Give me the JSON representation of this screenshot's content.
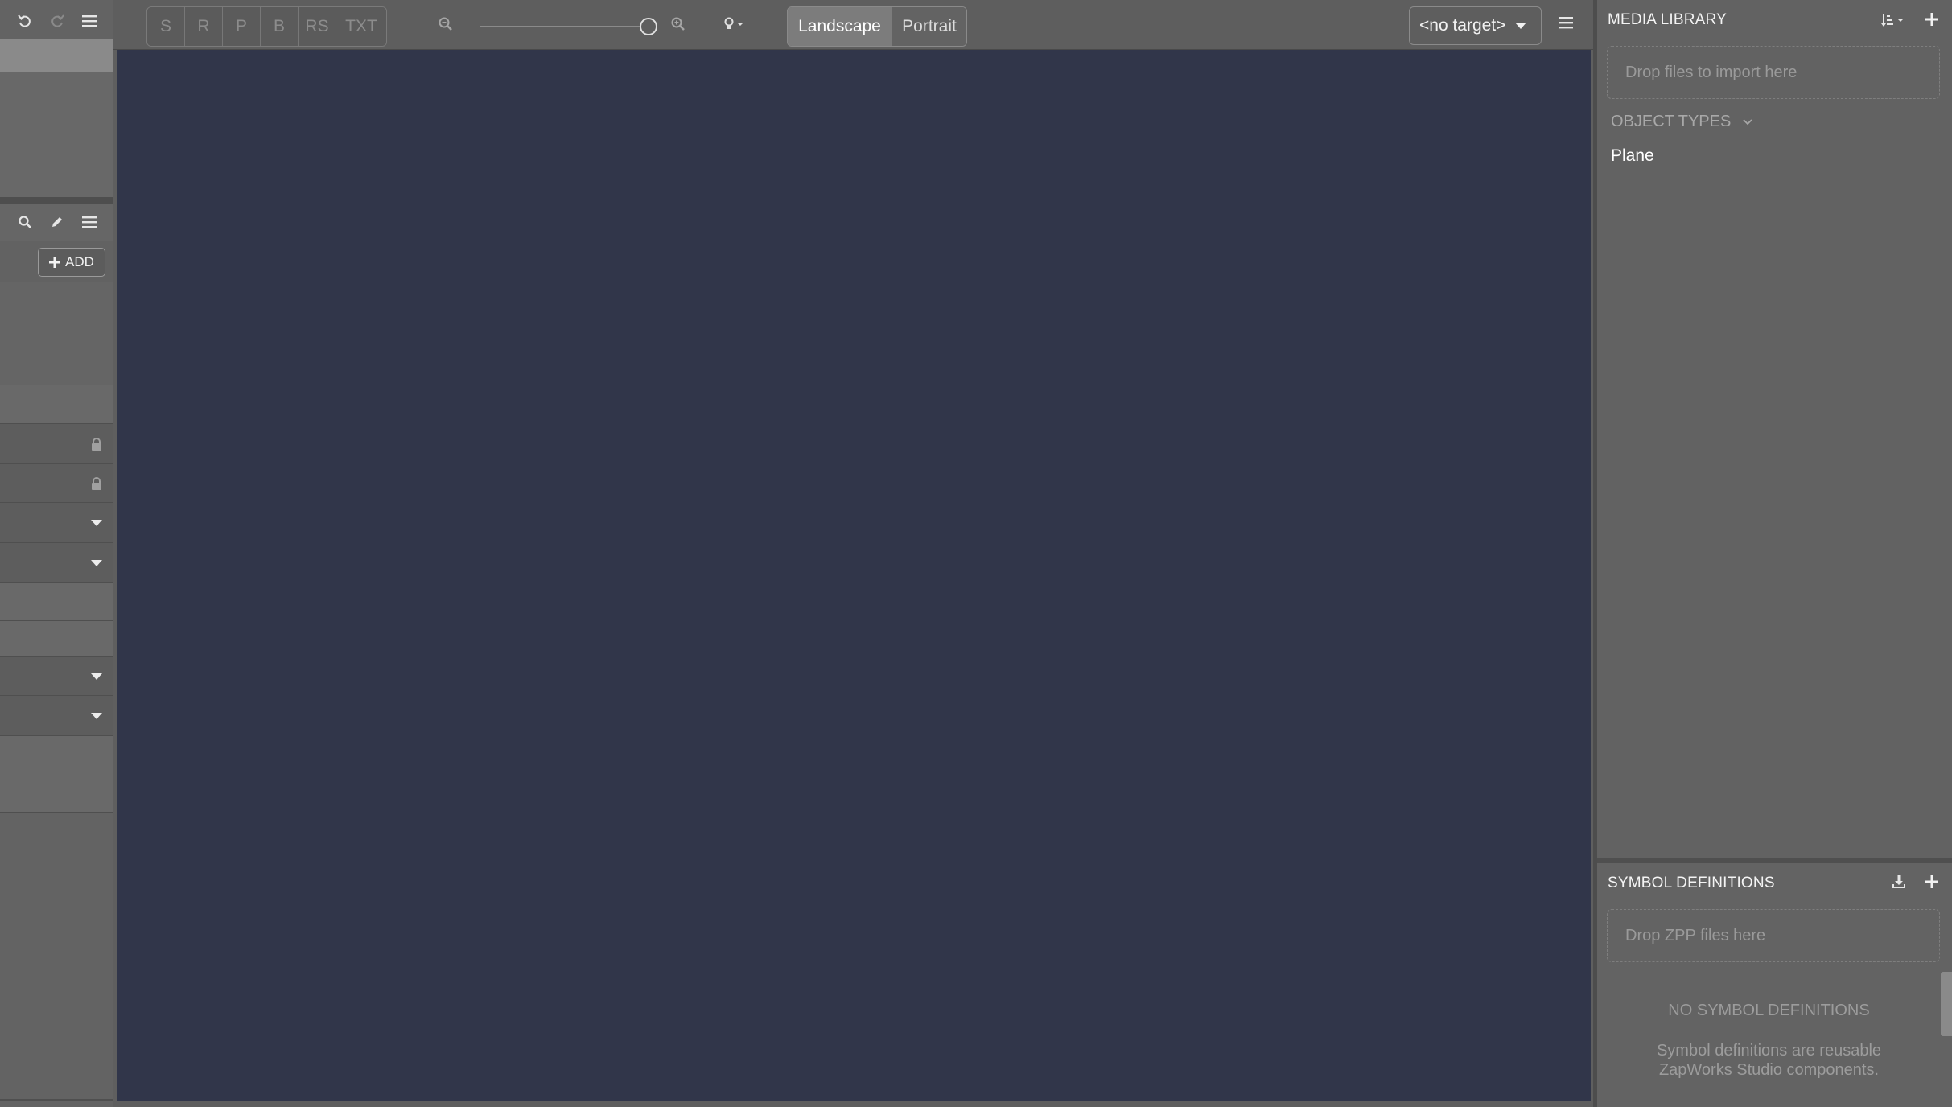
{
  "top_toolbar": {
    "transform_modes": [
      "S",
      "R",
      "P",
      "B",
      "RS",
      "TXT"
    ],
    "orientation": {
      "landscape": "Landscape",
      "portrait": "Portrait",
      "selected": "Landscape"
    },
    "target_dropdown": "<no target>"
  },
  "left_panel": {
    "add_label": "ADD"
  },
  "media_library": {
    "title": "MEDIA LIBRARY",
    "drop_placeholder": "Drop files to import here",
    "object_types_label": "OBJECT TYPES",
    "object_types": [
      "Plane"
    ]
  },
  "symbol_definitions": {
    "title": "SYMBOL DEFINITIONS",
    "drop_placeholder": "Drop ZPP files here",
    "empty_title": "NO SYMBOL DEFINITIONS",
    "empty_description": "Symbol definitions are reusable ZapWorks Studio components."
  },
  "colors": {
    "canvas": "#31364a",
    "panel": "#626262"
  }
}
